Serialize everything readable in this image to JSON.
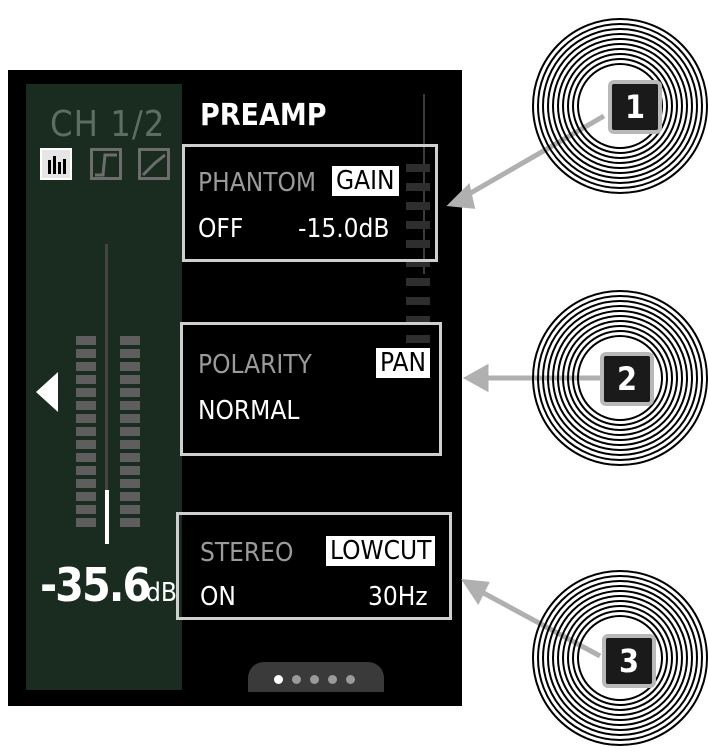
{
  "channel": {
    "label": "CH 1/2"
  },
  "tabs": [
    {
      "name": "meter-view",
      "active": true
    },
    {
      "name": "filter-view",
      "active": false
    },
    {
      "name": "dynamics-view",
      "active": false
    }
  ],
  "level": {
    "value": "-35.6",
    "unit": "dB"
  },
  "title": "PREAMP",
  "params": {
    "phantom": {
      "label": "PHANTOM",
      "value": "OFF"
    },
    "gain": {
      "label": "GAIN",
      "value": "-15.0dB"
    },
    "polarity": {
      "label": "POLARITY",
      "value": "NORMAL"
    },
    "pan": {
      "label": "PAN"
    },
    "stereo": {
      "label": "STEREO",
      "value": "ON"
    },
    "lowcut": {
      "label": "LOWCUT",
      "value": "30Hz"
    }
  },
  "pagination": {
    "pages": 5,
    "active": 1
  },
  "callouts": [
    "1",
    "2",
    "3"
  ],
  "colors": {
    "background": "#000000",
    "panel": "#1a2b20",
    "highlight": "#ffffff",
    "callout_arrow": "#b0b0b0"
  }
}
